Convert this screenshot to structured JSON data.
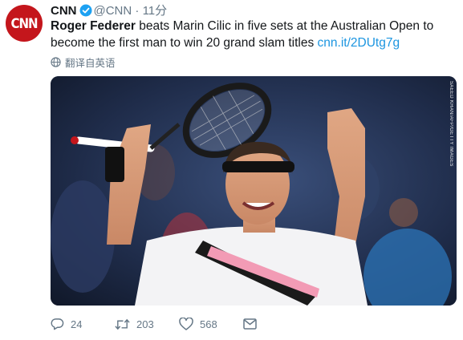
{
  "tweet": {
    "avatar_logo": "CNN",
    "author_name": "CNN",
    "handle": "@CNN",
    "separator": "·",
    "time": "11分",
    "text_bold": "Roger Federer",
    "text_rest": " beats Marin Cilic in five sets at the Australian Open to become the first man to win 20 grand slam titles ",
    "link": "cnn.it/2DUtg7g",
    "translate_label": "翻译自英语",
    "photo_credit": "SAEED KHAN/AFP/GETTY IMAGES"
  },
  "actions": {
    "reply_count": "24",
    "retweet_count": "203",
    "like_count": "568"
  },
  "colors": {
    "brand": "#c4161c",
    "link": "#1b95e0",
    "muted": "#657786",
    "verified": "#1da1f2"
  },
  "icons": [
    "verified-badge-icon",
    "translate-globe-icon",
    "reply-icon",
    "retweet-icon",
    "like-icon",
    "message-icon"
  ]
}
